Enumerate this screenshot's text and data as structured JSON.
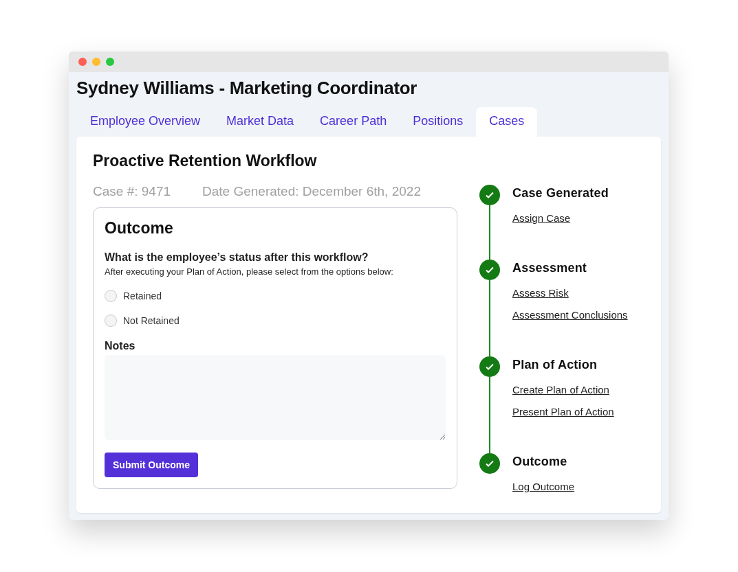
{
  "window": {
    "title": "Sydney Williams - Marketing Coordinator"
  },
  "tabs": [
    {
      "label": "Employee Overview",
      "selected": false
    },
    {
      "label": "Market Data",
      "selected": false
    },
    {
      "label": "Career Path",
      "selected": false
    },
    {
      "label": "Positions",
      "selected": false
    },
    {
      "label": "Cases",
      "selected": true
    }
  ],
  "panel": {
    "title": "Proactive Retention Workflow",
    "case_number": "Case #: 9471",
    "date_generated": "Date Generated: December 6th, 2022"
  },
  "outcome": {
    "title": "Outcome",
    "question": "What is the employee’s status after this workflow?",
    "instruction": "After executing your Plan of Action, please select from the options below:",
    "options": [
      {
        "label": "Retained",
        "selected": false
      },
      {
        "label": "Not Retained",
        "selected": false
      }
    ],
    "notes_label": "Notes",
    "submit": "Submit Outcome"
  },
  "timeline": [
    {
      "title": "Case Generated",
      "completed": true,
      "links": [
        "Assign Case"
      ]
    },
    {
      "title": "Assessment",
      "completed": true,
      "links": [
        "Assess Risk",
        "Assessment Conclusions"
      ]
    },
    {
      "title": "Plan of Action",
      "completed": true,
      "links": [
        "Create Plan of Action",
        "Present Plan of Action"
      ]
    },
    {
      "title": "Outcome",
      "completed": true,
      "links": [
        "Log Outcome"
      ]
    }
  ]
}
